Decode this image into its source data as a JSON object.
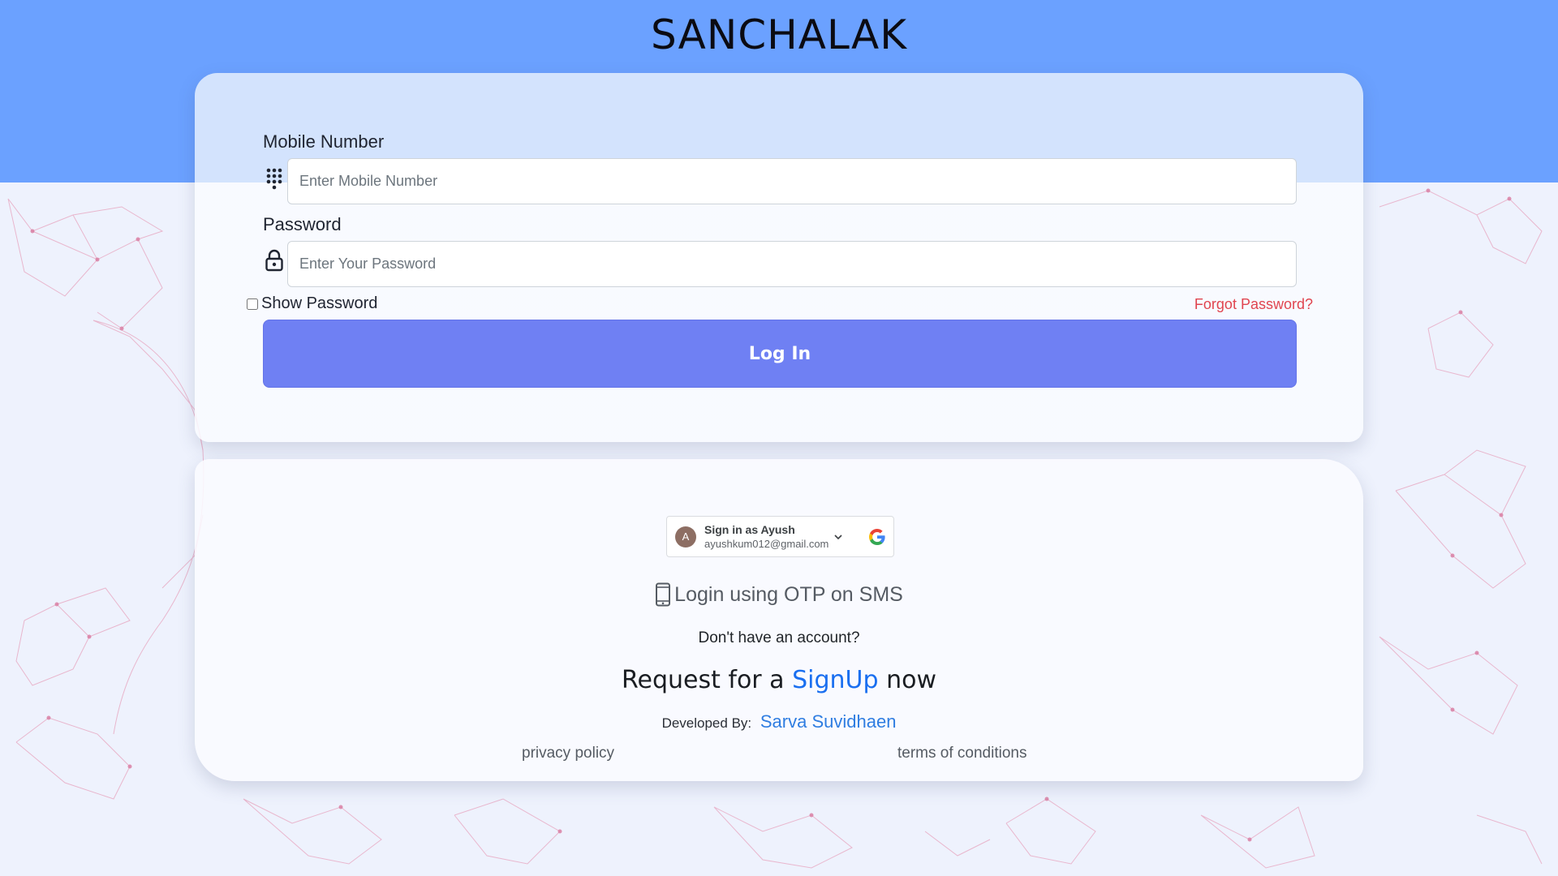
{
  "header": {
    "title": "SANCHALAK"
  },
  "login_form": {
    "mobile_label": "Mobile Number",
    "mobile_placeholder": "Enter Mobile Number",
    "password_label": "Password",
    "password_placeholder": "Enter Your Password",
    "show_password_label": "Show Password",
    "forgot_password_label": "Forgot Password?",
    "login_button_label": "Log In"
  },
  "google_signin": {
    "avatar_letter": "A",
    "title": "Sign in as Ayush",
    "email": "ayushkum012@gmail.com"
  },
  "alternatives": {
    "otp_label": "Login using OTP on SMS",
    "no_account_text": "Don't have an account?",
    "signup_prefix": "Request for a",
    "signup_link": "SignUp",
    "signup_suffix": "now",
    "developed_by_label": "Developed By:",
    "developer_name": "Sarva Suvidhaen"
  },
  "footer": {
    "privacy_label": "privacy policy",
    "terms_label": "terms of conditions"
  },
  "colors": {
    "header_band": "#6ba1ff",
    "login_button": "#6f80f3",
    "forgot_link": "#e0454f",
    "signup_link": "#1a6ff0"
  }
}
